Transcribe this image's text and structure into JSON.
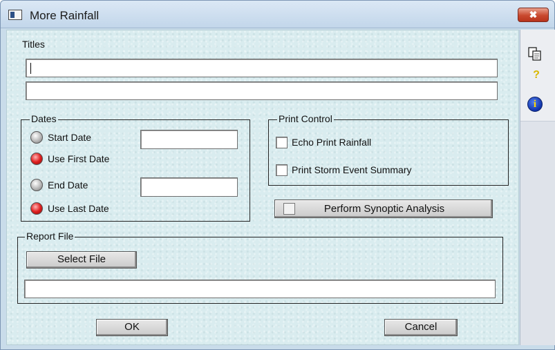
{
  "window": {
    "title": "More Rainfall",
    "close_glyph": "✖"
  },
  "titles": {
    "label": "Titles",
    "line1": "",
    "line2": ""
  },
  "dates": {
    "legend": "Dates",
    "start_date_label": "Start Date",
    "start_date_value": "",
    "start_date_selected": false,
    "use_first_date_label": "Use First Date",
    "use_first_date_selected": true,
    "end_date_label": "End Date",
    "end_date_value": "",
    "end_date_selected": false,
    "use_last_date_label": "Use Last Date",
    "use_last_date_selected": true
  },
  "print_control": {
    "legend": "Print Control",
    "echo_print_rainfall_label": "Echo Print Rainfall",
    "echo_print_rainfall_checked": false,
    "print_storm_event_summary_label": "Print Storm Event Summary",
    "print_storm_event_summary_checked": false
  },
  "synoptic": {
    "label": "Perform Synoptic Analysis",
    "checked": false
  },
  "report_file": {
    "legend": "Report File",
    "select_file_label": "Select File",
    "path": ""
  },
  "buttons": {
    "ok_label": "OK",
    "cancel_label": "Cancel"
  },
  "side_toolbar": {
    "icons": [
      "copy-icon",
      "help-icon",
      "info-icon"
    ],
    "help_glyph": "?",
    "info_glyph": "i"
  },
  "colors": {
    "selected_radio": "#e02020",
    "panel_background": "#d9ecef",
    "close_button": "#c9492f"
  }
}
